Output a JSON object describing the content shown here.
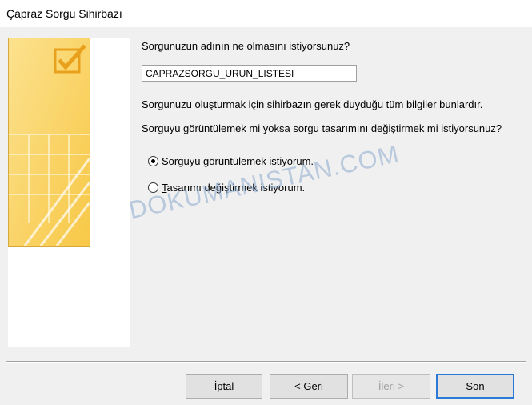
{
  "window": {
    "title": "Çapraz Sorgu Sihirbazı"
  },
  "side_panel": {
    "icon": "wizard-checkbox-art"
  },
  "form": {
    "name_question": "Sorgunuzun adının ne olmasını istiyorsunuz?",
    "query_name": "CAPRAZSORGU_URUN_LISTESI",
    "info_text": "Sorgunuzu oluşturmak için sihirbazın gerek duyduğu tüm bilgiler bunlardır.",
    "view_question": "Sorguyu görüntülemek mi yoksa sorgu tasarımını değiştirmek mi istiyorsunuz?",
    "options": [
      {
        "mnemonic": "S",
        "rest": "orguyu görüntülemek istiyorum.",
        "selected": true
      },
      {
        "mnemonic": "T",
        "rest": "asarımı değiştirmek istiyorum.",
        "selected": false
      }
    ]
  },
  "watermark": "DOKUMANISTAN.COM",
  "buttons": {
    "cancel": {
      "mnemonic": "İ",
      "rest": "ptal"
    },
    "back": {
      "pre": "< ",
      "mnemonic": "G",
      "rest": "eri"
    },
    "next": {
      "mnemonic": "İ",
      "rest": "leri >",
      "enabled": false
    },
    "finish": {
      "mnemonic": "S",
      "rest": "on"
    }
  },
  "colors": {
    "art_light": "#fde9a2",
    "art_dark": "#f7c235",
    "accent": "#2b79d6"
  }
}
